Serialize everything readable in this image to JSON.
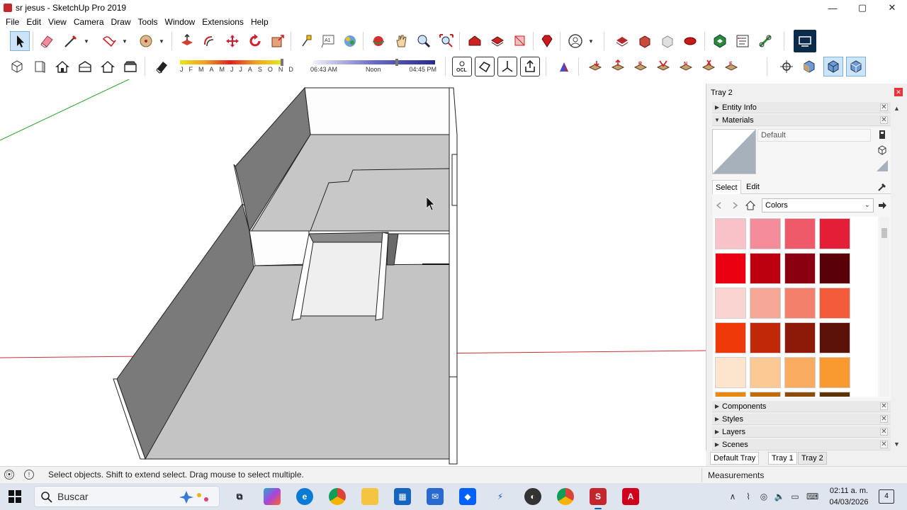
{
  "window": {
    "title": "sr jesus - SketchUp Pro 2019",
    "minimize": "—",
    "maximize": "▢",
    "close": "✕"
  },
  "menu": [
    "File",
    "Edit",
    "View",
    "Camera",
    "Draw",
    "Tools",
    "Window",
    "Extensions",
    "Help"
  ],
  "shadow": {
    "months": [
      "J",
      "F",
      "M",
      "A",
      "M",
      "J",
      "J",
      "A",
      "S",
      "O",
      "N",
      "D"
    ],
    "time_start": "06:43 AM",
    "time_mid": "Noon",
    "time_end": "04:45 PM"
  },
  "toolbar_icons": {
    "row1": [
      "select-icon",
      "eraser-icon",
      "line-icon",
      "freehand-icon",
      "circle-icon",
      "push-pull-icon",
      "offset-icon",
      "move-icon",
      "rotate-icon",
      "scale-icon",
      "tape-measure-icon",
      "text-icon",
      "paint-bucket-icon",
      "orbit-icon",
      "pan-icon",
      "zoom-icon",
      "zoom-extents-icon",
      "warehouse-icon",
      "extension-warehouse-icon",
      "layout-icon",
      "ruby-icon",
      "account-icon",
      "sandbox-icon",
      "solid-tools-icon",
      "section-plane-icon",
      "style-icon",
      "component-icon",
      "console-icon",
      "plugin-icon",
      "dialog-icon"
    ],
    "row2": [
      "iso-view-icon",
      "front-view-icon",
      "home-view-icon",
      "back-view-icon",
      "left-view-icon",
      "right-view-icon",
      "eraser-shadow-icon",
      "ocl-icon",
      "shape-icon",
      "axes-icon",
      "export-icon",
      "paint-icon",
      "tool-a-icon",
      "tool-b-icon",
      "tool-c-icon",
      "tool-d-icon",
      "tool-e-icon",
      "tool-f-icon",
      "tool-g-icon",
      "walk-icon",
      "cube-view-a-icon",
      "cube-view-b-icon",
      "cube-view-c-icon"
    ]
  },
  "tray": {
    "title": "Tray 2",
    "panels": {
      "entity_info": "Entity Info",
      "materials": "Materials",
      "components": "Components",
      "styles": "Styles",
      "layers": "Layers",
      "scenes": "Scenes"
    },
    "material_name": "Default",
    "tabs": {
      "select": "Select",
      "edit": "Edit"
    },
    "library": "Colors",
    "swatch_colors": [
      "#f8c2c8",
      "#f48c9c",
      "#ef5a6a",
      "#e41e36",
      "#ea0010",
      "#bc0010",
      "#8a0010",
      "#5a0008",
      "#fad4d0",
      "#f6a898",
      "#f2806a",
      "#f25a3a",
      "#ee3a08",
      "#c02808",
      "#8c1a08",
      "#5c1208",
      "#fde4cc",
      "#fcc894",
      "#f9ac60",
      "#f99a30",
      "#e88a10",
      "#c06a08",
      "#8c4c08",
      "#5c3208"
    ],
    "bottom_tabs": [
      "Default Tray",
      "Tray 1",
      "Tray 2"
    ]
  },
  "status": {
    "text": "Select objects. Shift to extend select. Drag mouse to select multiple.",
    "measurements_label": "Measurements"
  },
  "taskbar": {
    "search_placeholder": "Buscar",
    "time": "02:11 a. m.",
    "date": "04/03/2026",
    "notifications": "4"
  }
}
